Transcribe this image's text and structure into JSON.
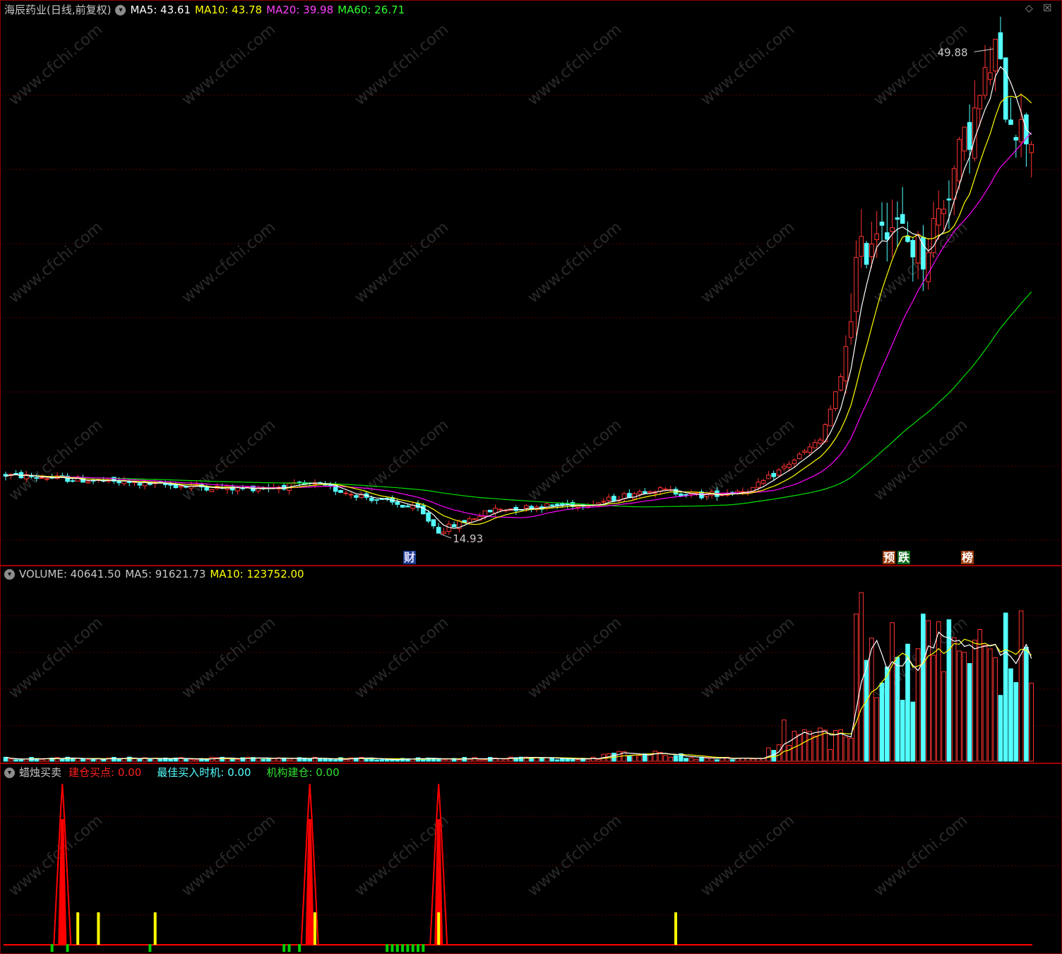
{
  "main": {
    "title": "海辰药业(日线,前复权)",
    "ma5": "MA5: 43.61",
    "ma10": "MA10: 43.78",
    "ma20": "MA20: 39.98",
    "ma60": "MA60: 26.71",
    "high_label": "49.88",
    "low_label": "14.93",
    "tags": [
      "财",
      "预",
      "跌",
      "榜"
    ],
    "corner_icon": "diamond-icon",
    "corner_icon2": "close-box-icon"
  },
  "volume": {
    "title": "VOLUME: 40641.50",
    "ma5": "MA5: 91621.73",
    "ma10": "MA10: 123752.00"
  },
  "indicator": {
    "title": "蜡烛买卖",
    "l1": "建仓买点: 0.00",
    "l2": "最佳买入时机: 0.00",
    "l3": "机构建仓: 0.00"
  },
  "watermark": "www.cfchi.com",
  "colors": {
    "up": "#ff3232",
    "down": "#54ffff",
    "ma5": "#ffffff",
    "ma10": "#ffff00",
    "ma20": "#ff00ff",
    "ma60": "#00e000"
  },
  "chart_data": {
    "type": "candlestick",
    "price_range": [
      13.5,
      52
    ],
    "high": 49.88,
    "low": 14.93,
    "ma_last": {
      "ma5": 43.61,
      "ma10": 43.78,
      "ma20": 39.98,
      "ma60": 26.71
    },
    "volume_last": 40641.5,
    "volume_ma_last": {
      "ma5": 91621.73,
      "ma10": 123752.0
    },
    "indicator_last": {
      "建仓买点": 0.0,
      "最佳买入时机": 0.0,
      "机构建仓": 0.0
    }
  }
}
